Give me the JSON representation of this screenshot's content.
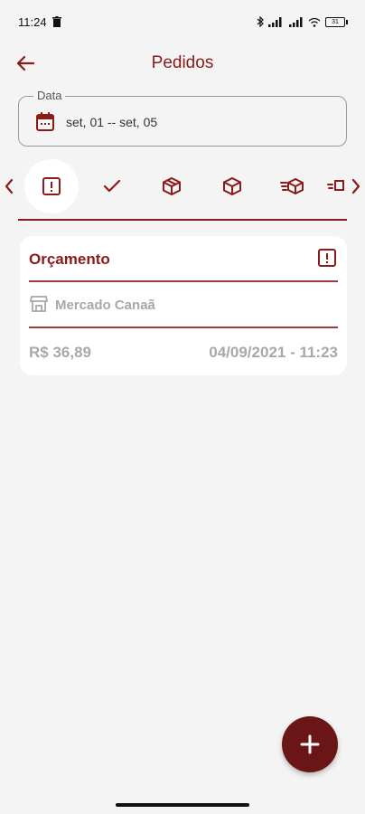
{
  "status_bar": {
    "time": "11:24",
    "battery": "31"
  },
  "header": {
    "title": "Pedidos"
  },
  "date_filter": {
    "label": "Data",
    "value": "set, 01 -- set, 05"
  },
  "status_tabs": [
    "exclamation-box-icon",
    "check-icon",
    "box-outline-icon",
    "box-icon",
    "fast-delivery-icon",
    "truck-icon"
  ],
  "order": {
    "status": "Orçamento",
    "store": "Mercado Canaã",
    "total": "R$ 36,89",
    "datetime": "04/09/2021 - 11:23"
  },
  "colors": {
    "accent": "#8b1a1a",
    "fab": "#6b1616",
    "muted": "#a8a8a8",
    "background": "#f4f4f4"
  }
}
